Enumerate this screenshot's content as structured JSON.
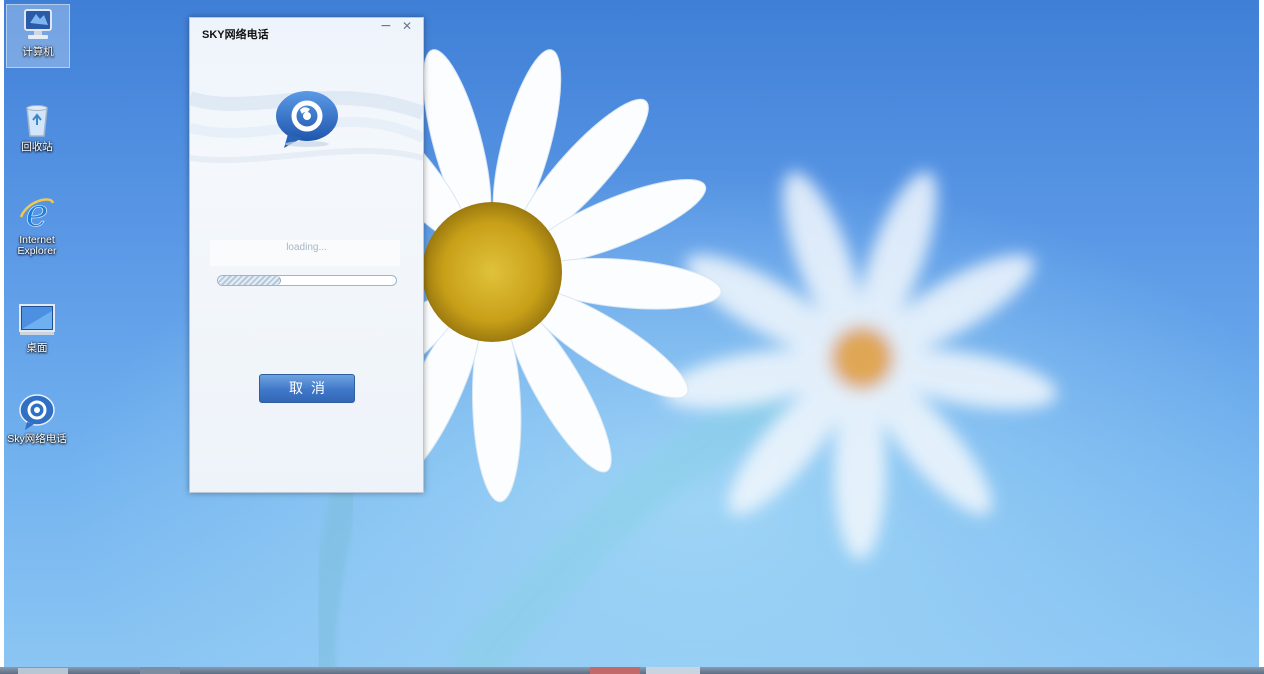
{
  "desktop": {
    "icons": [
      {
        "label": "计算机",
        "icon": "computer-icon"
      },
      {
        "label": "回收站",
        "icon": "recycle-bin-icon"
      },
      {
        "label": "Internet Explorer",
        "icon": "internet-explorer-icon"
      },
      {
        "label": "桌面",
        "icon": "desktop-folder-icon"
      },
      {
        "label": "Sky网络电话",
        "icon": "sky-phone-icon"
      }
    ]
  },
  "window": {
    "title": "SKY网络电话",
    "minimize_glyph": "−",
    "close_glyph": "✕",
    "loading_text": "loading...",
    "progress_fraction": 0.35,
    "cancel_label": "取消"
  },
  "colors": {
    "accent": "#3f78c8",
    "wallpaper_top": "#3f7fd6",
    "wallpaper_bottom": "#8cc6f3"
  }
}
